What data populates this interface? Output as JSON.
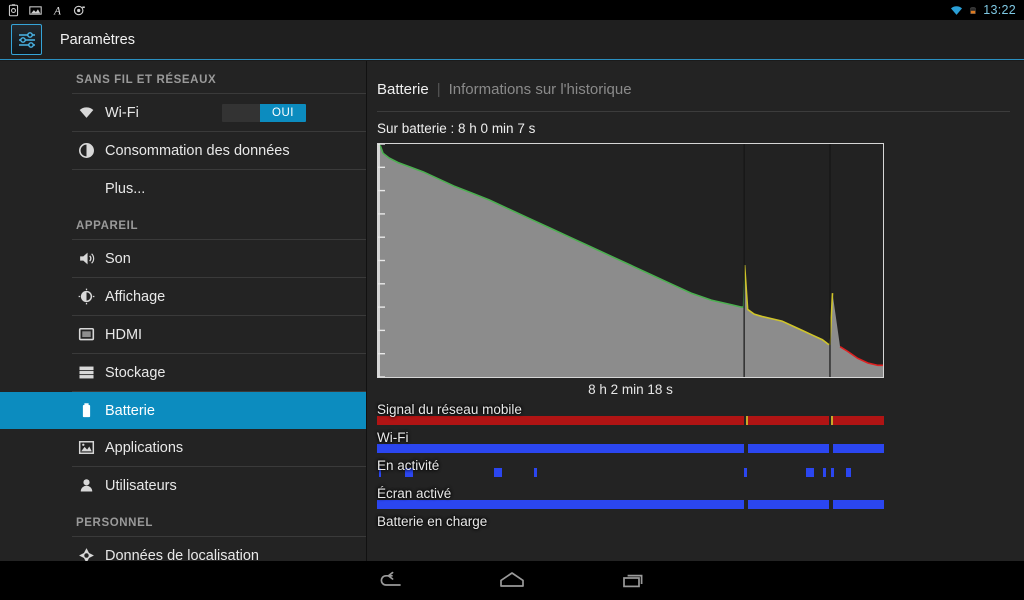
{
  "statusbar": {
    "time": "13:22",
    "left_icons": [
      "settings-box-icon",
      "image-icon",
      "letter-a-icon",
      "camera-icon"
    ],
    "right_icons": [
      "wifi-icon",
      "battery-icon"
    ],
    "wifi_color": "#2a9fd6",
    "battery_color": "#e07b20"
  },
  "actionbar": {
    "title": "Paramètres",
    "icon": "settings-sliders-icon",
    "accent": "#2a8fc0"
  },
  "sidebar": {
    "groups": [
      {
        "header": "SANS FIL ET RÉSEAUX",
        "items": [
          {
            "label": "Wi-Fi",
            "icon": "wifi-icon",
            "toggle": "OUI",
            "selected": false
          },
          {
            "label": "Consommation des données",
            "icon": "data-usage-icon",
            "selected": false
          },
          {
            "label": "Plus...",
            "icon": null,
            "selected": false
          }
        ]
      },
      {
        "header": "APPAREIL",
        "items": [
          {
            "label": "Son",
            "icon": "sound-icon",
            "selected": false
          },
          {
            "label": "Affichage",
            "icon": "display-brightness-icon",
            "selected": false
          },
          {
            "label": "HDMI",
            "icon": "hdmi-monitor-icon",
            "selected": false
          },
          {
            "label": "Stockage",
            "icon": "storage-icon",
            "selected": false
          },
          {
            "label": "Batterie",
            "icon": "battery-icon",
            "selected": true
          },
          {
            "label": "Applications",
            "icon": "applications-icon",
            "selected": false
          },
          {
            "label": "Utilisateurs",
            "icon": "users-icon",
            "selected": false
          }
        ]
      },
      {
        "header": "PERSONNEL",
        "items": [
          {
            "label": "Données de localisation",
            "icon": "location-icon",
            "selected": false
          }
        ]
      }
    ],
    "selected_color": "#0c8cbf"
  },
  "panel": {
    "tab_main": "Batterie",
    "tab_separator": "|",
    "tab_sub": "Informations sur l'historique",
    "battery_status": "Sur batterie : 8 h 0 min 7 s",
    "chart_caption": "8 h 2 min 18 s"
  },
  "activity_rows": [
    {
      "label": "Signal du réseau mobile",
      "name": "mobile-signal-row",
      "type": "bar",
      "color": "#b01414",
      "segments": [
        [
          0,
          72.4
        ],
        [
          73.2,
          89.2
        ],
        [
          90.0,
          100
        ]
      ],
      "dividers": [
        72.8,
        89.6
      ],
      "divider_color": "#c8a82a"
    },
    {
      "label": "Wi-Fi",
      "name": "wifi-row",
      "type": "bar",
      "color": "#2b46f0",
      "segments": [
        [
          0,
          72.4
        ],
        [
          73.2,
          89.2
        ],
        [
          90.0,
          100
        ]
      ],
      "dividers": [],
      "divider_color": "#222222"
    },
    {
      "label": "En activité",
      "name": "in-use-row",
      "type": "marks",
      "color": "#2b46f0",
      "marks": [
        [
          0.3,
          0.5
        ],
        [
          5.5,
          1.6
        ],
        [
          23.0,
          1.6
        ],
        [
          31.0,
          0.5
        ],
        [
          72.4,
          0.5
        ],
        [
          84.6,
          1.6
        ],
        [
          88.0,
          0.5
        ],
        [
          89.6,
          0.5
        ],
        [
          92.6,
          0.9
        ]
      ]
    },
    {
      "label": "Écran activé",
      "name": "screen-on-row",
      "type": "bar",
      "color": "#2b46f0",
      "segments": [
        [
          0,
          72.4
        ],
        [
          73.2,
          89.2
        ],
        [
          90.0,
          100
        ]
      ],
      "dividers": [],
      "divider_color": "#222222"
    },
    {
      "label": "Batterie en charge",
      "name": "battery-charging-row",
      "type": "bar",
      "color": "#2b46f0",
      "segments": [],
      "dividers": []
    }
  ],
  "chart_data": {
    "type": "area",
    "title": "Sur batterie : 8 h 0 min 7 s",
    "xlabel": "8 h 2 min 18 s",
    "ylabel": "",
    "xlim": [
      0,
      100
    ],
    "ylim": [
      0,
      100
    ],
    "grid": false,
    "legend": "none",
    "fill_color": "#8c8c8c",
    "background": "#222222",
    "axis_ticks_left": 10,
    "level_colors": {
      "good": "#4caf50",
      "warn": "#cfc42a",
      "critical": "#e02020"
    },
    "x": [
      0,
      0.5,
      1.0,
      2.2,
      4.0,
      6.5,
      9.0,
      12.0,
      15.0,
      18.5,
      22.0,
      26.0,
      30.0,
      34.0,
      38.0,
      42.0,
      46.0,
      50.0,
      54.0,
      58.0,
      62.0,
      66.0,
      70.0,
      72.0,
      72.4,
      72.6,
      73.2,
      74.5,
      76.0,
      78.0,
      80.0,
      82.0,
      84.0,
      86.0,
      88.0,
      89.2,
      89.5,
      90.0,
      91.5,
      93.0,
      95.0,
      97.0,
      99.0,
      100
    ],
    "y": [
      100,
      99,
      96,
      94,
      92,
      90,
      88,
      85,
      82,
      79,
      76,
      72,
      68,
      64,
      60,
      56,
      52,
      48,
      44,
      40,
      36,
      33,
      31,
      30,
      30,
      48,
      29,
      27,
      26,
      25,
      24,
      22,
      20,
      18,
      16,
      14,
      14,
      36,
      13,
      11,
      8,
      6,
      5,
      5
    ],
    "segments": [
      {
        "name": "green",
        "color": "#4caf50",
        "x_range": [
          0,
          72.6
        ]
      },
      {
        "name": "yellow",
        "color": "#cfc42a",
        "x_range": [
          72.6,
          90.5
        ]
      },
      {
        "name": "red",
        "color": "#e02020",
        "x_range": [
          90.5,
          100
        ]
      }
    ],
    "event_markers": [
      {
        "x": 72.5,
        "color": "#4caf50",
        "label": "spike-green"
      },
      {
        "x": 89.5,
        "color": "#cfc42a",
        "label": "spike-yellow"
      }
    ]
  },
  "navbar": {
    "buttons": [
      {
        "name": "back-button",
        "icon": "back-arrow-icon"
      },
      {
        "name": "home-button",
        "icon": "home-icon"
      },
      {
        "name": "recents-button",
        "icon": "recents-icon"
      }
    ]
  }
}
